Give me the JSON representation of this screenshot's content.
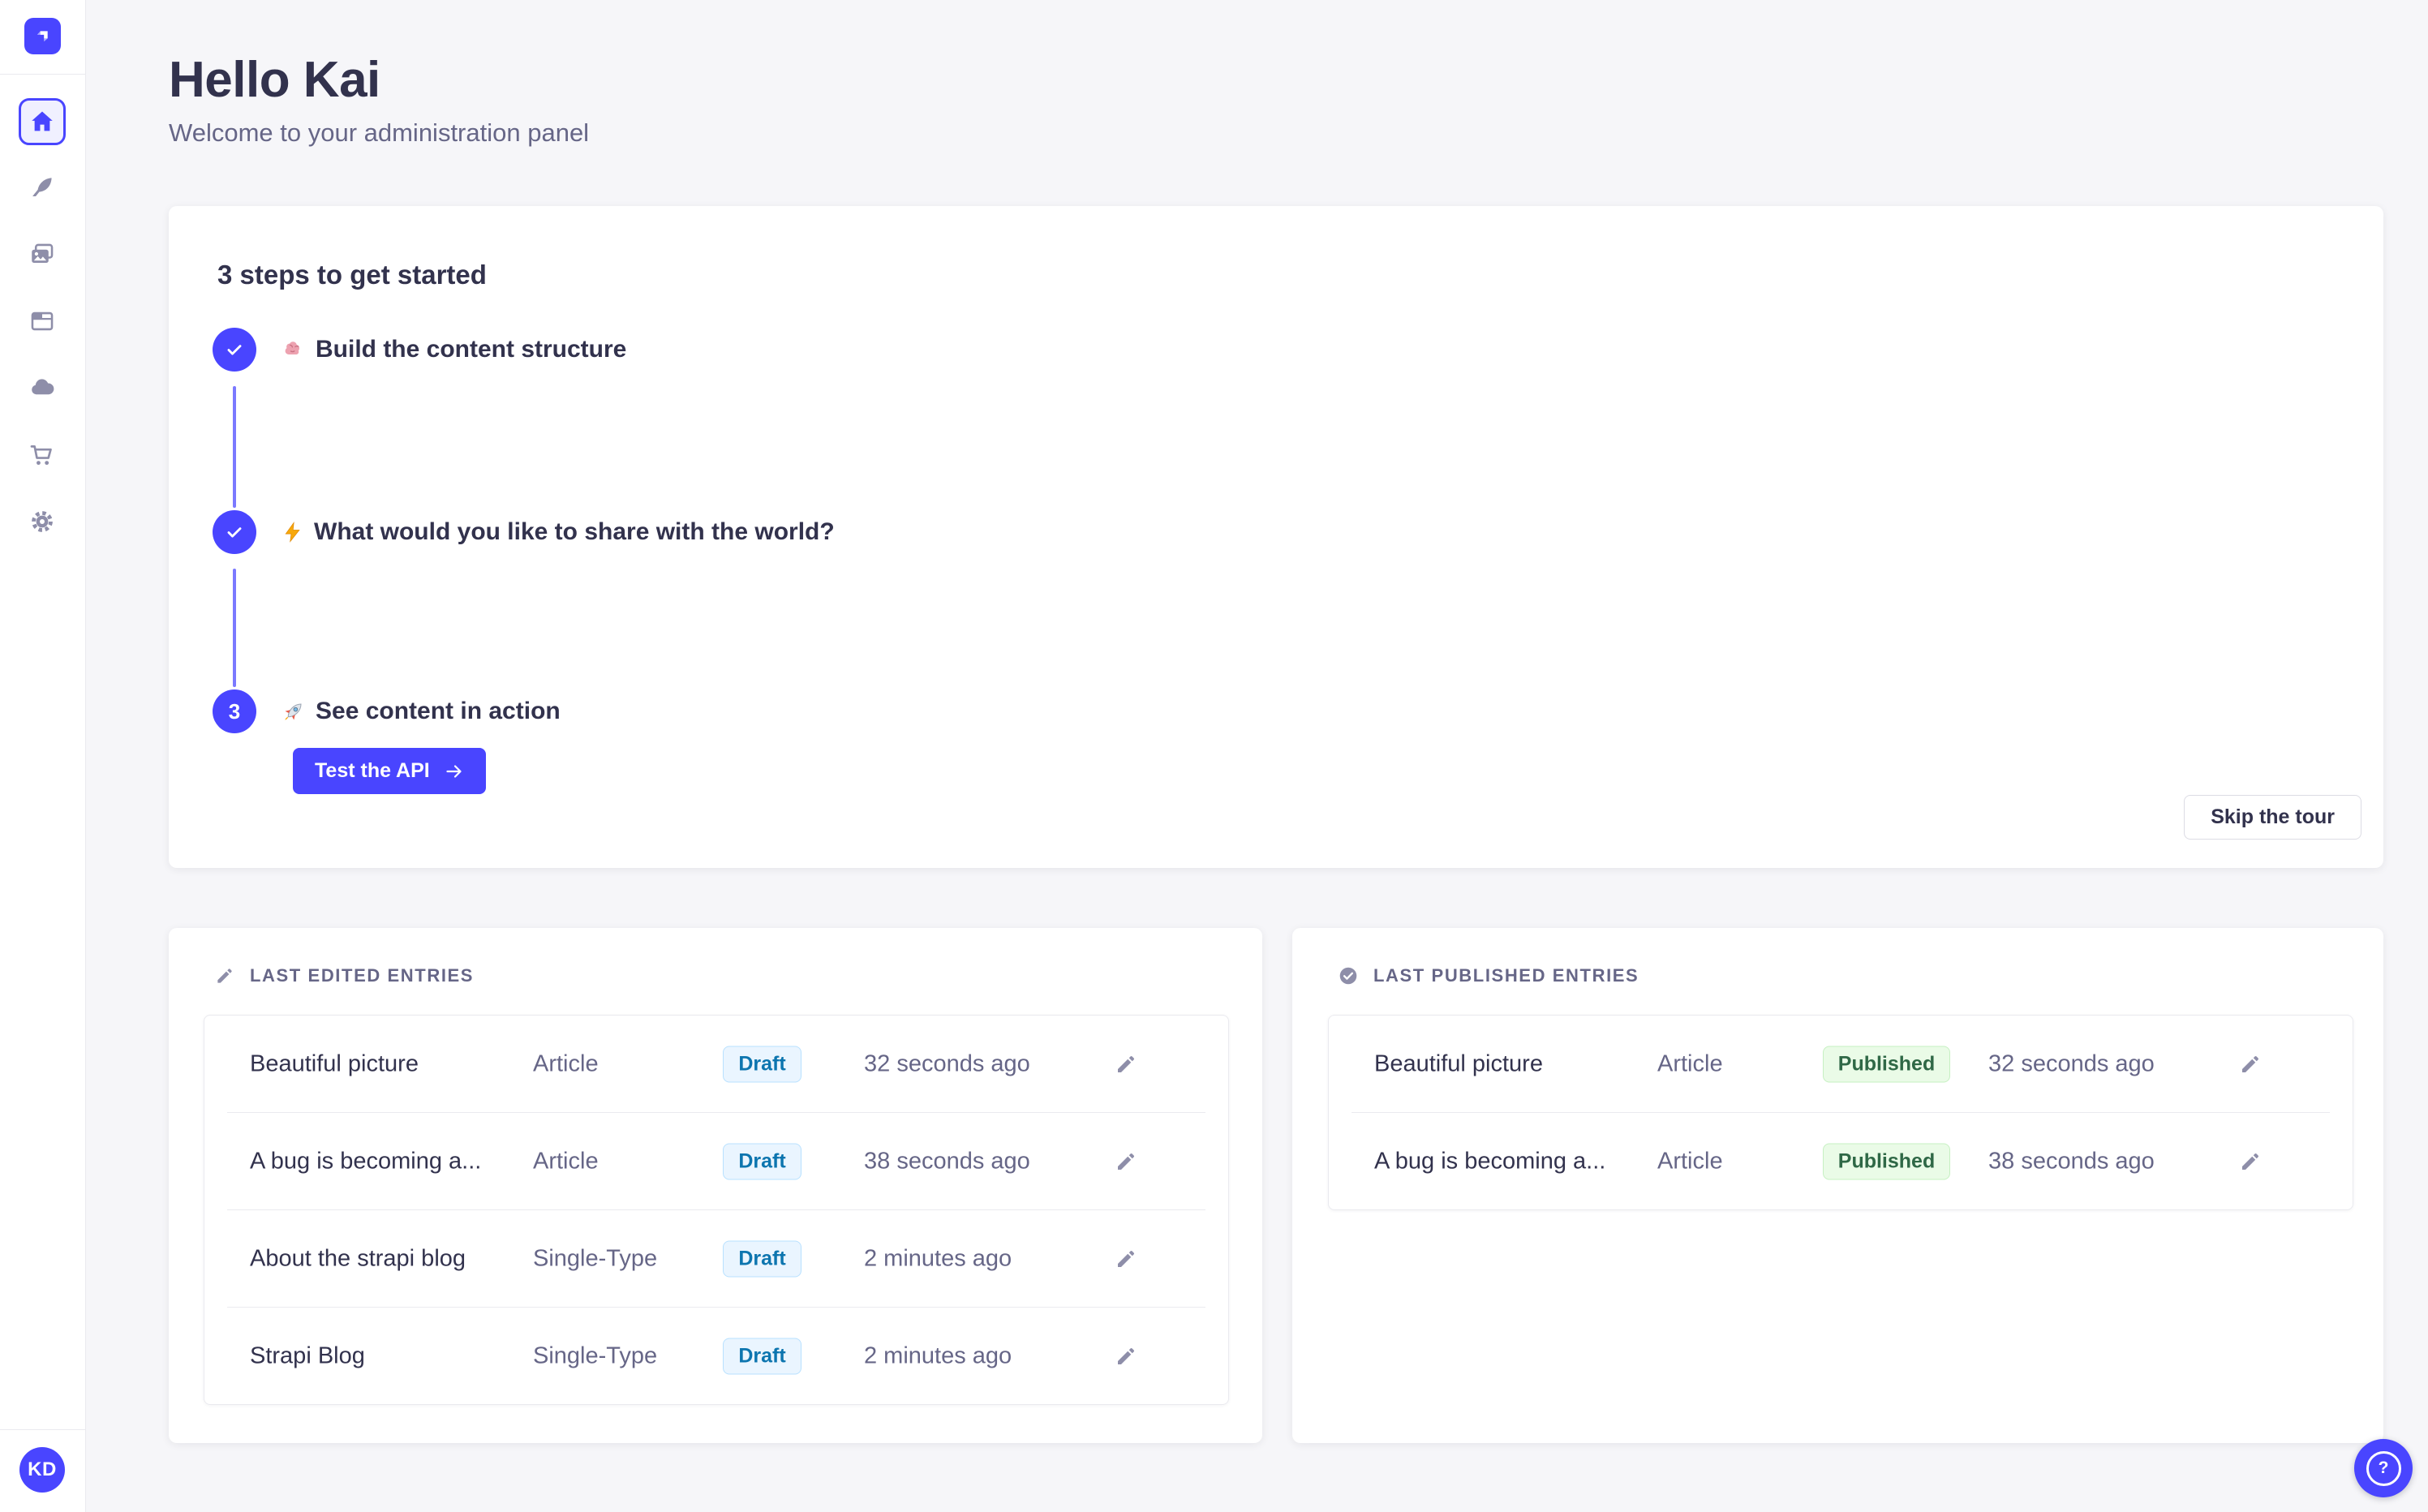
{
  "colors": {
    "primary": "#4945ff",
    "primary_light_line": "#7b79ff",
    "page_background": "#f6f6f9",
    "surface": "#ffffff",
    "text": "#32324d",
    "text_muted": "#666687",
    "icon_muted": "#8e8ea9",
    "border": "#eaeaef",
    "draft_bg": "#eaf5ff",
    "draft_border": "#b8e1ff",
    "draft_text": "#0c75af",
    "published_bg": "#eafbe7",
    "published_border": "#c6f0c2",
    "published_text": "#2f6846"
  },
  "sidebar": {
    "logo_icon": "strapi-logo",
    "items": [
      {
        "icon": "home-icon",
        "active": true
      },
      {
        "icon": "feather-icon",
        "active": false
      },
      {
        "icon": "media-library-icon",
        "active": false
      },
      {
        "icon": "layout-icon",
        "active": false
      },
      {
        "icon": "cloud-icon",
        "active": false
      },
      {
        "icon": "cart-icon",
        "active": false
      },
      {
        "icon": "gear-icon",
        "active": false
      }
    ],
    "avatar_initials": "KD"
  },
  "header": {
    "title": "Hello Kai",
    "subtitle": "Welcome to your administration panel"
  },
  "guided_tour": {
    "title": "3 steps to get started",
    "steps": [
      {
        "icon": "brain-emoji",
        "label": "Build the content structure",
        "done": true
      },
      {
        "icon": "zap-emoji",
        "label": "What would you like to share with the world?",
        "done": true
      },
      {
        "icon": "rocket-emoji",
        "label": "See content in action",
        "done": false,
        "number": "3",
        "cta_label": "Test the API"
      }
    ],
    "skip_label": "Skip the tour"
  },
  "last_edited": {
    "title": "LAST EDITED ENTRIES",
    "icon": "pencil-icon",
    "rows": [
      {
        "title": "Beautiful picture",
        "kind": "Article",
        "status": "Draft",
        "time": "32 seconds ago"
      },
      {
        "title": "A bug is becoming a...",
        "kind": "Article",
        "status": "Draft",
        "time": "38 seconds ago"
      },
      {
        "title": "About the strapi blog",
        "kind": "Single-Type",
        "status": "Draft",
        "time": "2 minutes ago"
      },
      {
        "title": "Strapi Blog",
        "kind": "Single-Type",
        "status": "Draft",
        "time": "2 minutes ago"
      }
    ]
  },
  "last_published": {
    "title": "LAST PUBLISHED ENTRIES",
    "icon": "check-circle-icon",
    "rows": [
      {
        "title": "Beautiful picture",
        "kind": "Article",
        "status": "Published",
        "time": "32 seconds ago"
      },
      {
        "title": "A bug is becoming a...",
        "kind": "Article",
        "status": "Published",
        "time": "38 seconds ago"
      }
    ]
  },
  "help": {
    "icon": "question-mark-circle-icon"
  }
}
